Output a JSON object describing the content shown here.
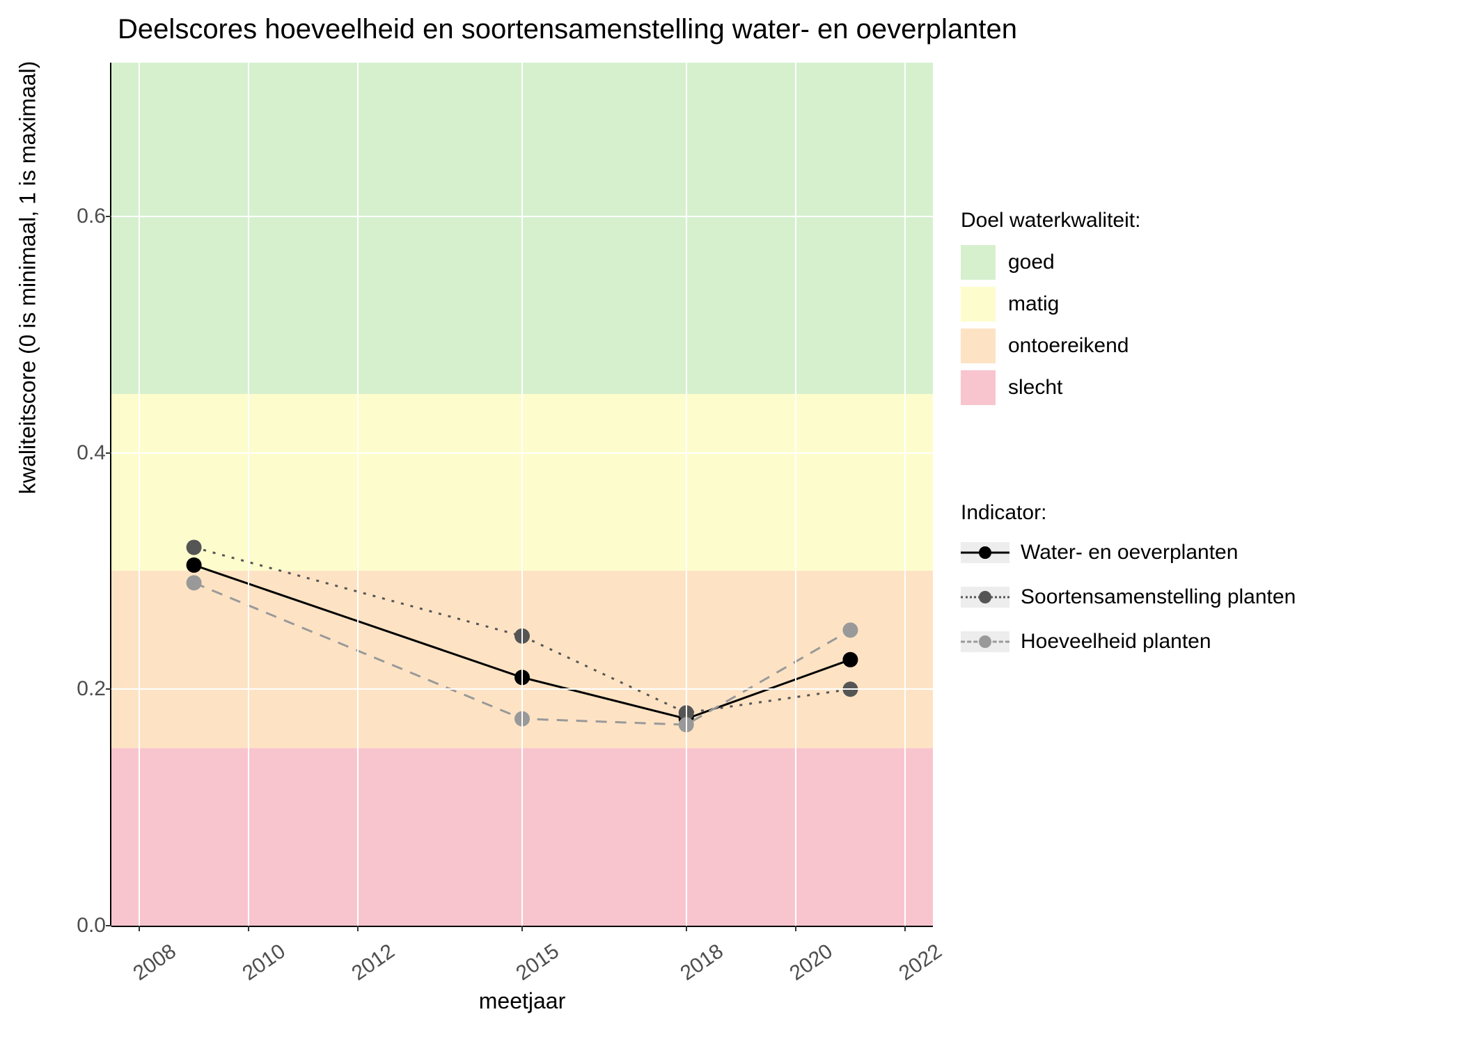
{
  "chart_data": {
    "type": "line",
    "title": "Deelscores hoeveelheid en soortensamenstelling water- en oeverplanten",
    "xlabel": "meetjaar",
    "ylabel": "kwaliteitscore (0 is minimaal, 1 is maximaal)",
    "xlim": [
      2008,
      2022
    ],
    "ylim": [
      0.0,
      0.73
    ],
    "x_ticks": [
      2008,
      2010,
      2012,
      2015,
      2018,
      2020,
      2022
    ],
    "y_ticks": [
      0.0,
      0.2,
      0.4,
      0.6
    ],
    "x": [
      2009,
      2015,
      2018,
      2021
    ],
    "series": [
      {
        "name": "Water- en oeverplanten",
        "values": [
          0.305,
          0.21,
          0.175,
          0.225
        ],
        "color": "#000000",
        "point_fill": "#000000",
        "dash": "solid"
      },
      {
        "name": "Soortensamenstelling planten",
        "values": [
          0.32,
          0.245,
          0.18,
          0.2
        ],
        "color": "#555555",
        "point_fill": "#555555",
        "dash": "dotted"
      },
      {
        "name": "Hoeveelheid planten",
        "values": [
          0.29,
          0.175,
          0.17,
          0.25
        ],
        "color": "#999999",
        "point_fill": "#999999",
        "dash": "dashed"
      }
    ],
    "bands": [
      {
        "name": "goed",
        "from": 0.45,
        "to": 0.73,
        "color": "#d6f0ce"
      },
      {
        "name": "matig",
        "from": 0.3,
        "to": 0.45,
        "color": "#fdfccd"
      },
      {
        "name": "ontoereikend",
        "from": 0.15,
        "to": 0.3,
        "color": "#fde3c4"
      },
      {
        "name": "slecht",
        "from": 0.0,
        "to": 0.15,
        "color": "#f8c5cf"
      }
    ],
    "legend_quality_title": "Doel waterkwaliteit:",
    "legend_indicator_title": "Indicator:"
  }
}
